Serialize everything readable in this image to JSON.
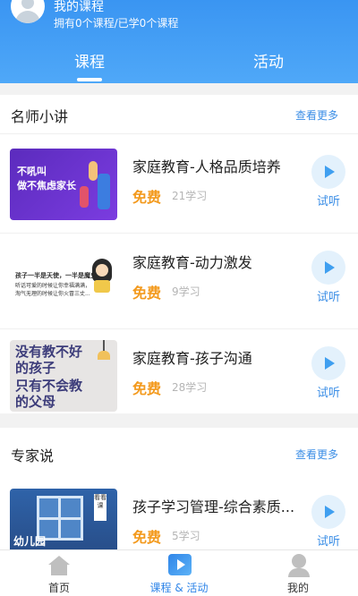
{
  "header": {
    "title": "我的课程",
    "subtitle": "拥有0个课程/已学0个课程",
    "tabs": [
      {
        "label": "课程",
        "active": true
      },
      {
        "label": "活动",
        "active": false
      }
    ],
    "accent": "#3a95f2"
  },
  "sections": [
    {
      "title": "名师小讲",
      "more": "查看更多",
      "items": [
        {
          "title": "家庭教育-人格品质培养",
          "price": "免费",
          "count": "21学习",
          "try": "试听",
          "thumb_text": [
            "不吼叫",
            "做不焦虑家长"
          ]
        },
        {
          "title": "家庭教育-动力激发",
          "price": "免费",
          "count": "9学习",
          "try": "试听",
          "thumb_text": [
            "孩子一半是天使，一半是魔鬼",
            "听话可爱的时候让你幸福满满，",
            "淘气无理的时候让你火冒三丈..."
          ]
        },
        {
          "title": "家庭教育-孩子沟通",
          "price": "免费",
          "count": "28学习",
          "try": "试听",
          "thumb_text": [
            "没有教不好",
            "的孩子",
            "只有不会教",
            "的父母"
          ]
        }
      ]
    },
    {
      "title": "专家说",
      "more": "查看更多",
      "items": [
        {
          "title": "孩子学习管理-综合素质...",
          "price": "免费",
          "count": "5学习",
          "try": "试听",
          "thumb_text": [
            "幼儿园",
            "看看课"
          ]
        }
      ]
    }
  ],
  "tabbar": [
    {
      "label": "首页",
      "icon": "home-icon",
      "active": false
    },
    {
      "label": "课程 & 活动",
      "icon": "course-icon",
      "active": true
    },
    {
      "label": "我的",
      "icon": "profile-icon",
      "active": false
    }
  ],
  "colors": {
    "active": "#2f85e8",
    "inactive": "#333333",
    "price": "#f39a1e",
    "link": "#3b8ee6"
  }
}
